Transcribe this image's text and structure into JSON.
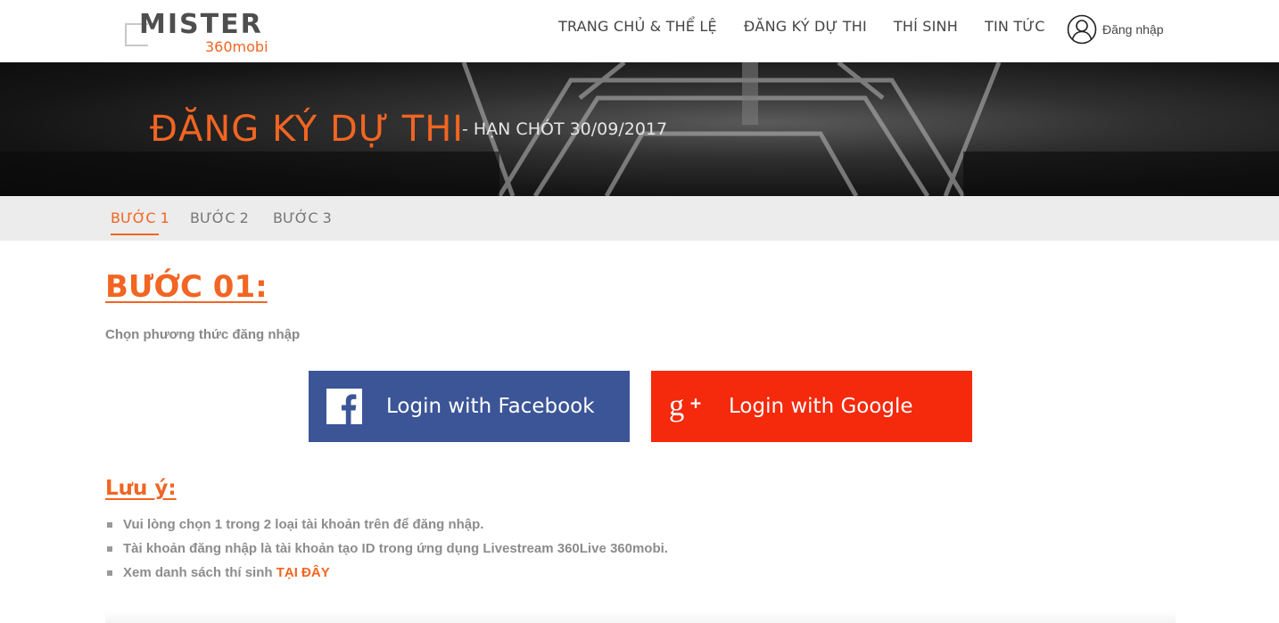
{
  "header": {
    "logo": {
      "brand": "MISTER",
      "sub": "360mobi"
    },
    "nav": [
      {
        "label": "TRANG CHỦ & THỂ LỆ"
      },
      {
        "label": "ĐĂNG KÝ DỰ THI"
      },
      {
        "label": "THÍ SINH"
      },
      {
        "label": "TIN TỨC"
      }
    ],
    "login_label": "Đăng nhập"
  },
  "banner": {
    "title": "ĐĂNG KÝ DỰ THI",
    "subtitle": "- HẠN CHÓT 30/09/2017"
  },
  "steps": [
    {
      "label": "BƯỚC 1",
      "active": true
    },
    {
      "label": "BƯỚC 2",
      "active": false
    },
    {
      "label": "BƯỚC 3",
      "active": false
    }
  ],
  "content": {
    "heading": "BƯỚC 01:",
    "instruction": "Chọn phương thức đăng nhập",
    "facebook_button": "Login with Facebook",
    "google_button": "Login with Google",
    "note_heading": "Lưu ý:",
    "notes": [
      "Vui lòng chọn 1 trong 2 loại tài khoản trên để đăng nhập.",
      "Tài khoản đăng nhập là tài khoản tạo ID trong ứng dụng Livestream 360Live 360mobi.",
      "Xem danh sách thí sinh"
    ],
    "notes_link": "TẠI ĐÂY"
  },
  "colors": {
    "accent": "#f26522",
    "facebook": "#3b5597",
    "google": "#f5290b",
    "steps_bg": "#ececec"
  },
  "icons": [
    "user-circle-icon",
    "facebook-icon",
    "google-plus-icon"
  ]
}
